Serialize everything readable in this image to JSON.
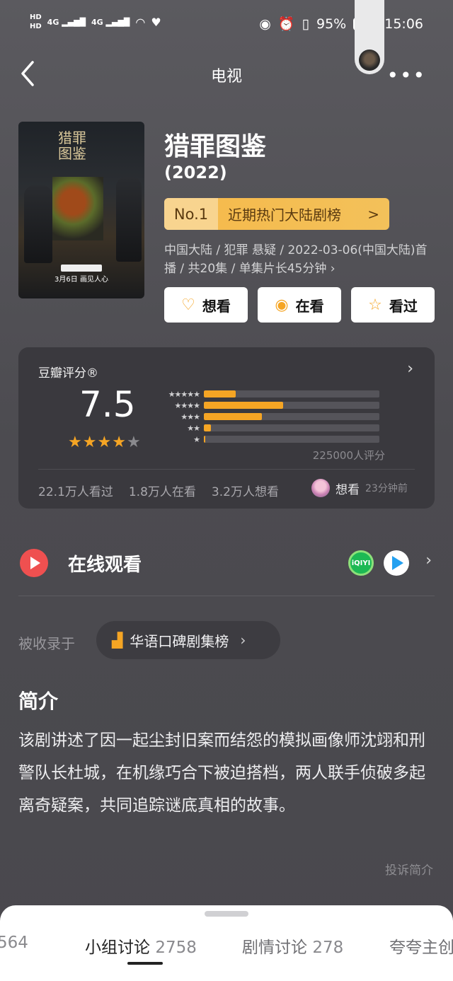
{
  "status_bar": {
    "hd1": "HD",
    "hd2": "HD",
    "signal1": "4G",
    "signal2": "4G",
    "battery_pct": "95%",
    "time": "15:06"
  },
  "nav": {
    "back_icon": "chevron-left-icon",
    "title": "电视",
    "more_icon": "more-dots-icon"
  },
  "poster": {
    "title_art": "猎罪图鉴",
    "date_text": "3月6日  画见人心"
  },
  "header": {
    "title": "猎罪图鉴",
    "year": "(2022)",
    "rank": {
      "no": "No.1",
      "label": "近期热门大陆剧榜",
      "chevron": ">"
    },
    "meta": "中国大陆 / 犯罪 悬疑 / 2022-03-06(中国大陆)首播 / 共20集 / 单集片长45分钟 ›"
  },
  "actions": {
    "want": {
      "label": "想看",
      "icon": "heart-plus-icon"
    },
    "watching": {
      "label": "在看",
      "icon": "target-icon"
    },
    "watched": {
      "label": "看过",
      "icon": "star-outline-icon"
    }
  },
  "rating": {
    "label": "豆瓣评分®",
    "score": "7.5",
    "stars_filled": 4,
    "distribution": [
      {
        "stars": "★★★★★",
        "fraction": 0.18
      },
      {
        "stars": "★★★★",
        "fraction": 0.45
      },
      {
        "stars": "★★★",
        "fraction": 0.33
      },
      {
        "stars": "★★",
        "fraction": 0.04
      },
      {
        "stars": "★",
        "fraction": 0.01
      }
    ],
    "count": "225000人评分",
    "stats": {
      "watched": "22.1万人看过",
      "watching": "1.8万人在看",
      "want": "3.2万人想看"
    },
    "recent": {
      "action": "想看",
      "time": "23分钟前"
    }
  },
  "online": {
    "label": "在线观看",
    "iqiyi": "iQIYI",
    "tencent_icon": "tencent-video-icon"
  },
  "included": {
    "label": "被收录于",
    "chip": "华语口碑剧集榜"
  },
  "intro": {
    "heading": "简介",
    "text": "该剧讲述了因一起尘封旧案而结怨的模拟画像师沈翊和刑警队长杜城，在机缘巧合下被迫搭档，两人联手侦破多起离奇疑案，共同追踪谜底真相的故事。",
    "report": "投诉简介"
  },
  "bottom_tabs": [
    {
      "label": "",
      "count": "564"
    },
    {
      "label": "小组讨论",
      "count": "2758"
    },
    {
      "label": "剧情讨论",
      "count": "278"
    },
    {
      "label": "夸夸主创",
      "count": ""
    }
  ],
  "colors": {
    "accent": "#f5a524",
    "play": "#ef5050",
    "card": "#3a393e"
  }
}
